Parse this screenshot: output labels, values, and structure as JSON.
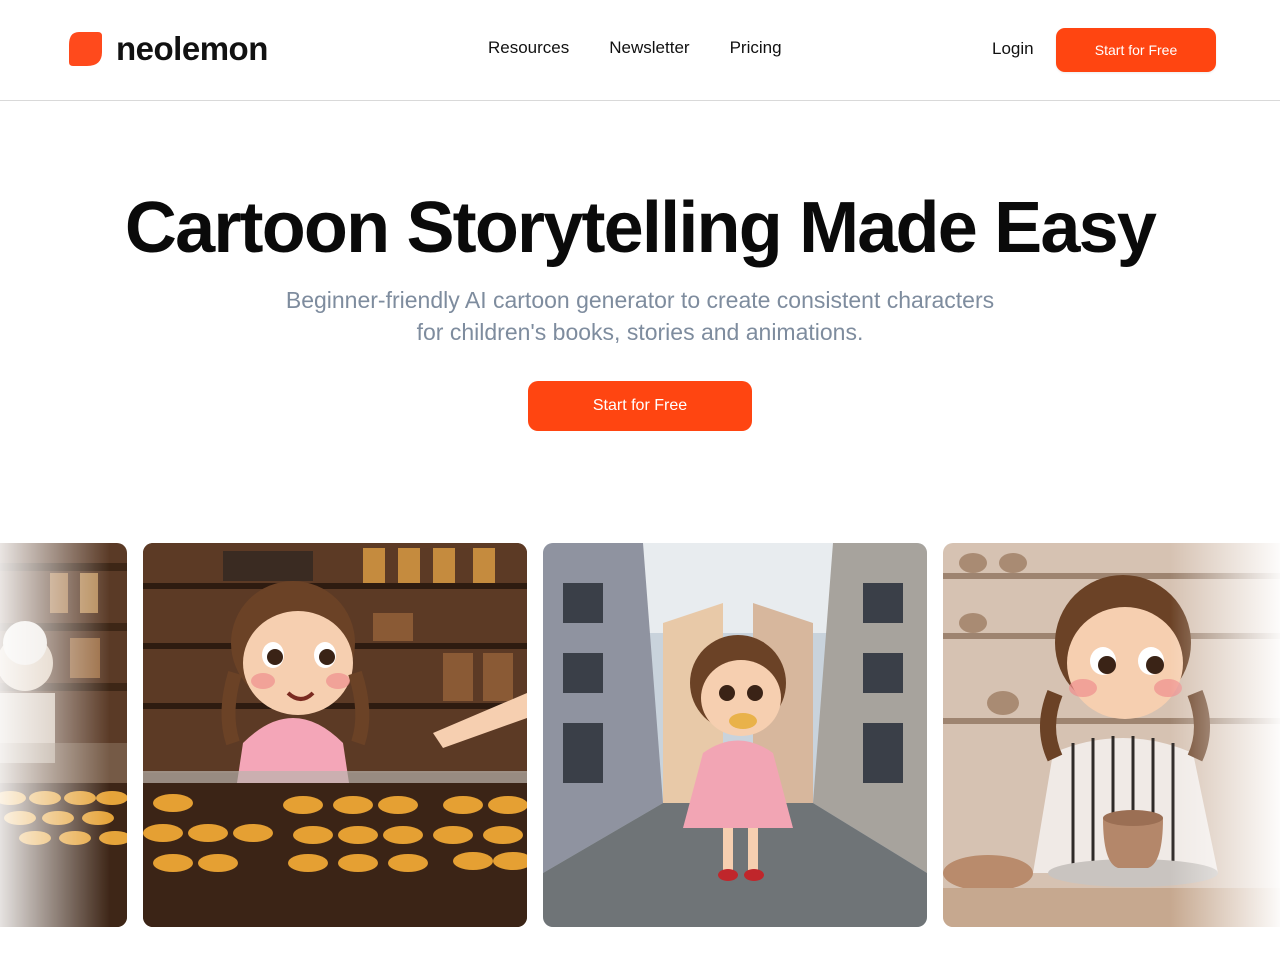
{
  "header": {
    "logo_text": "neolemon",
    "nav": [
      {
        "label": "Resources"
      },
      {
        "label": "Newsletter"
      },
      {
        "label": "Pricing"
      }
    ],
    "login_label": "Login",
    "cta_label": "Start for Free"
  },
  "hero": {
    "title": "Cartoon Storytelling Made Easy",
    "subtitle_line1": "Beginner-friendly AI cartoon generator to create consistent characters",
    "subtitle_line2": "for children's books, stories and animations.",
    "cta_label": "Start for Free"
  },
  "colors": {
    "accent": "#ff4511",
    "subtitle": "#7e8c9e",
    "border": "#d9d9d9"
  }
}
